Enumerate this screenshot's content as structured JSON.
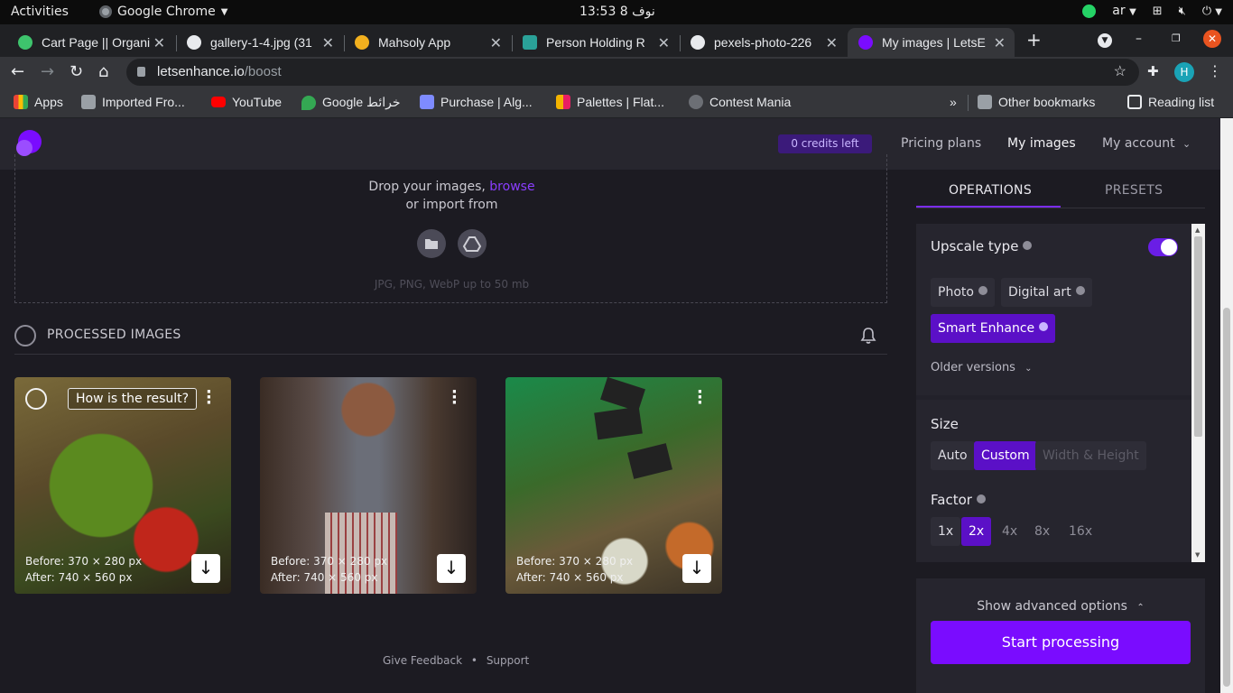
{
  "os_bar": {
    "activities": "Activities",
    "app": "Google Chrome",
    "clock": "13:53  8 نوف",
    "lang": "ar"
  },
  "tabs": [
    {
      "title": "Cart Page || Organi",
      "favicon_color": "#3ec46d"
    },
    {
      "title": "gallery-1-4.jpg (31",
      "favicon_color": "#e8eaed"
    },
    {
      "title": "Mahsoly App",
      "favicon_color": "#f2b01e"
    },
    {
      "title": "Person Holding R",
      "favicon_color": "#2aa198"
    },
    {
      "title": "pexels-photo-226",
      "favicon_color": "#e8eaed"
    },
    {
      "title": "My images | LetsE",
      "favicon_color": "#7a0cff"
    }
  ],
  "address": {
    "host": "letsenhance.io",
    "path": "/boost"
  },
  "profile_initial": "H",
  "bookmarks": [
    {
      "label": "Apps",
      "color": "#ea4335"
    },
    {
      "label": "Imported Fro...",
      "color": "#9aa0a6"
    },
    {
      "label": "YouTube",
      "color": "#ff0000"
    },
    {
      "label": "Google خرائط",
      "color": "#34a853"
    },
    {
      "label": "Purchase | Alg...",
      "color": "#7e8bff"
    },
    {
      "label": "Palettes | Flat...",
      "color": "#f4b400"
    },
    {
      "label": "Contest Mania",
      "color": "#6c6f75"
    }
  ],
  "bookmarks_right": {
    "more": "»",
    "other": "Other bookmarks",
    "reading": "Reading list"
  },
  "site": {
    "credits": "0 credits left",
    "nav": [
      "Pricing plans",
      "My images",
      "My account"
    ],
    "brand_color": "#7a0cff"
  },
  "dropzone": {
    "text_pre": "Drop your images, ",
    "browse": "browse",
    "import": "or import from",
    "hint": "JPG, PNG, WebP up to 50 mb"
  },
  "processed": {
    "title": "PROCESSED IMAGES",
    "tooltip": "How is the result?",
    "images": [
      {
        "before": "Before: 370 × 280 px",
        "after": "After: 740 × 560 px",
        "subject": "basket of vegetables"
      },
      {
        "before": "Before: 370 × 280 px",
        "after": "After: 740 × 560 px",
        "subject": "person pouring oil"
      },
      {
        "before": "Before: 370 × 280 px",
        "after": "After: 740 × 560 px",
        "subject": "market carrots"
      }
    ]
  },
  "footer": {
    "feedback": "Give Feedback",
    "sep": "•",
    "support": "Support"
  },
  "panel": {
    "tabs": [
      "OPERATIONS",
      "PRESETS"
    ],
    "upscale_label": "Upscale type",
    "upscale_options": [
      "Photo",
      "Digital art",
      "Smart Enhance"
    ],
    "upscale_selected": "Smart Enhance",
    "older": "Older versions",
    "size_label": "Size",
    "size_options": [
      "Auto",
      "Custom",
      "Width & Height"
    ],
    "size_selected": "Custom",
    "factor_label": "Factor",
    "factor_options": [
      "1x",
      "2x",
      "4x",
      "8x",
      "16x"
    ],
    "factor_selected": "2x",
    "advanced": "Show advanced options",
    "start": "Start processing"
  }
}
